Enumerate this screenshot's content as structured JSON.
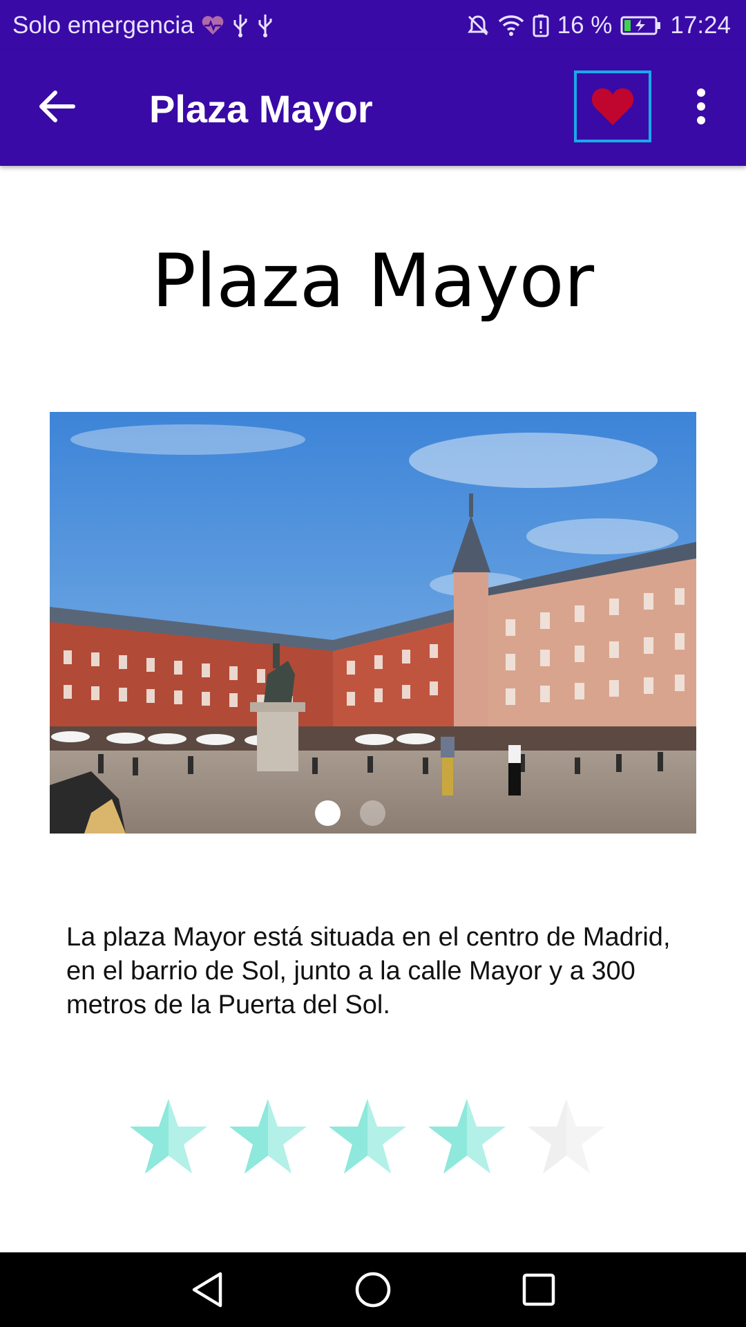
{
  "status_bar": {
    "carrier": "Solo emergencia",
    "battery_percent": "16 %",
    "time": "17:24",
    "icons": [
      "health-heart-icon",
      "usb-icon",
      "usb-icon",
      "mute-icon",
      "wifi-icon",
      "battery-alert-icon",
      "battery-charging-icon"
    ]
  },
  "app_bar": {
    "title": "Plaza Mayor",
    "back_icon": "arrow-back-icon",
    "favorite_icon": "heart-icon",
    "menu_icon": "more-vert-icon",
    "favorite_color": "#c0062e",
    "background": "#3a0aa6"
  },
  "content": {
    "title": "Plaza Mayor",
    "carousel": {
      "current_index": 1,
      "total": 2
    },
    "description": "La plaza Mayor está situada en el centro de Madrid, en el barrio de Sol, junto a la calle Mayor y a 300 metros de la Puerta del Sol.",
    "rating": {
      "value": 4,
      "max": 5,
      "filled_color": "#8ee8dc",
      "empty_color": "#f2f2f2"
    }
  },
  "nav_bar": {
    "icons": [
      "back-triangle-icon",
      "home-circle-icon",
      "recents-square-icon"
    ]
  }
}
